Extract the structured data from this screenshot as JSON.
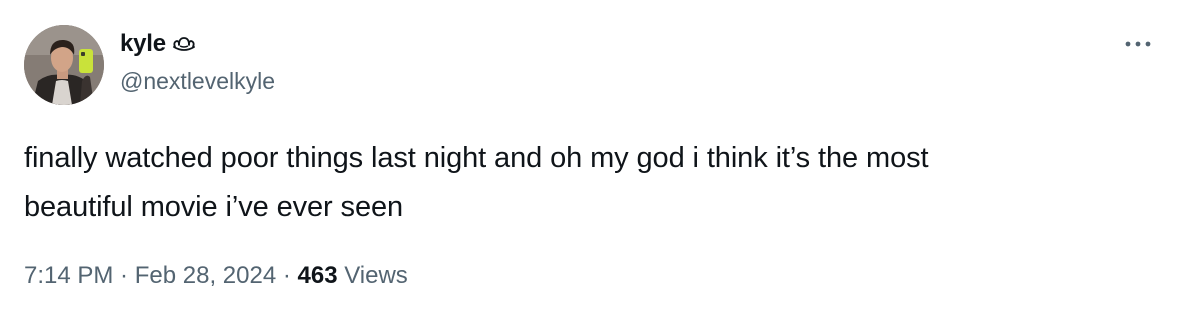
{
  "author": {
    "display_name": "kyle",
    "name_emoji_icon": "cowboy-hat-icon",
    "handle": "@nextlevelkyle"
  },
  "tweet": {
    "text_line_1": "finally watched poor things last night and oh my god i think it’s the most",
    "text_line_2": "beautiful movie i’ve ever seen"
  },
  "meta": {
    "time": "7:14 PM",
    "sep1": " · ",
    "date": "Feb 28, 2024",
    "sep2": " · ",
    "views_count": "463",
    "views_label": " Views"
  },
  "colors": {
    "text_primary": "#0f1419",
    "text_secondary": "#536471",
    "background": "#ffffff"
  }
}
